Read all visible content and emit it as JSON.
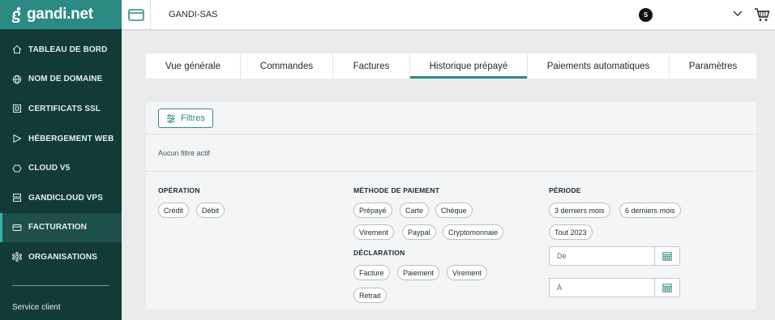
{
  "brand": {
    "name": "gandi.net"
  },
  "sidebar": {
    "items": [
      {
        "label": "TABLEAU DE BORD",
        "icon": "home-icon"
      },
      {
        "label": "NOM DE DOMAINE",
        "icon": "globe-icon"
      },
      {
        "label": "CERTIFICATS SSL",
        "icon": "certificate-icon"
      },
      {
        "label": "HÉBERGEMENT WEB",
        "icon": "web-hosting-icon"
      },
      {
        "label": "CLOUD V5",
        "icon": "cloud-icon"
      },
      {
        "label": "GANDICLOUD VPS",
        "icon": "server-icon"
      },
      {
        "label": "FACTURATION",
        "icon": "billing-card-icon",
        "active": true
      },
      {
        "label": "ORGANISATIONS",
        "icon": "organisation-icon"
      }
    ],
    "service_label": "Service client"
  },
  "topbar": {
    "org": "GANDI-SAS",
    "avatar_letter": "S"
  },
  "tabs": [
    {
      "label": "Vue générale"
    },
    {
      "label": "Commandes"
    },
    {
      "label": "Factures"
    },
    {
      "label": "Historique prépayé",
      "active": true
    },
    {
      "label": "Paiements automatiques"
    },
    {
      "label": "Paramètres"
    }
  ],
  "filters": {
    "button_label": "Filtres",
    "none_active": "Aucun filtre actif",
    "operation": {
      "title": "OPÉRATION",
      "chips": [
        "Crédit",
        "Débit"
      ]
    },
    "payment_method": {
      "title": "MÉTHODE DE PAIEMENT",
      "chips": [
        "Prépayé",
        "Carte",
        "Chèque",
        "Virement",
        "Paypal",
        "Cryptomonnaie"
      ]
    },
    "declaration": {
      "title": "DÉCLARATION",
      "chips": [
        "Facture",
        "Paiement",
        "Virement",
        "Retrait"
      ]
    },
    "period": {
      "title": "PÉRIODE",
      "chips": [
        "3 derniers mois",
        "6 derniers mois",
        "Tout 2023"
      ],
      "from_placeholder": "De",
      "to_placeholder": "À"
    }
  },
  "colors": {
    "sidebar": "#123b37",
    "brand": "#2b8a84",
    "accent": "#30b3a8"
  }
}
